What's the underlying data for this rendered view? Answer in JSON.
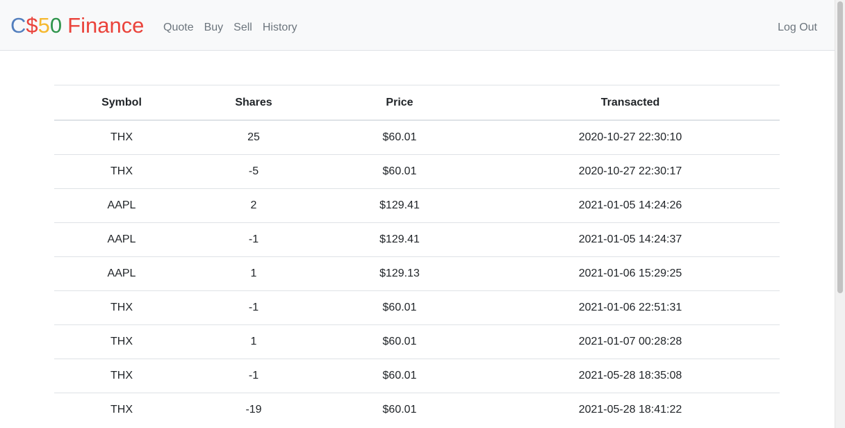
{
  "navbar": {
    "brand": {
      "c": "C",
      "dollar": "$",
      "five": "5",
      "zero": "0",
      "finance": "Finance"
    },
    "links": [
      "Quote",
      "Buy",
      "Sell",
      "History"
    ],
    "logout": "Log Out"
  },
  "table": {
    "headers": [
      "Symbol",
      "Shares",
      "Price",
      "Transacted"
    ],
    "rows": [
      [
        "THX",
        "25",
        "$60.01",
        "2020-10-27 22:30:10"
      ],
      [
        "THX",
        "-5",
        "$60.01",
        "2020-10-27 22:30:17"
      ],
      [
        "AAPL",
        "2",
        "$129.41",
        "2021-01-05 14:24:26"
      ],
      [
        "AAPL",
        "-1",
        "$129.41",
        "2021-01-05 14:24:37"
      ],
      [
        "AAPL",
        "1",
        "$129.13",
        "2021-01-06 15:29:25"
      ],
      [
        "THX",
        "-1",
        "$60.01",
        "2021-01-06 22:51:31"
      ],
      [
        "THX",
        "1",
        "$60.01",
        "2021-01-07 00:28:28"
      ],
      [
        "THX",
        "-1",
        "$60.01",
        "2021-05-28 18:35:08"
      ],
      [
        "THX",
        "-19",
        "$60.01",
        "2021-05-28 18:41:22"
      ]
    ]
  },
  "colors": {
    "brand_blue": "#537fbe",
    "brand_red": "#ea433b",
    "brand_yellow": "#f5b82e",
    "brand_green": "#2e944b",
    "navbar_bg": "#f8f9fa",
    "nav_link": "#6c757d"
  }
}
